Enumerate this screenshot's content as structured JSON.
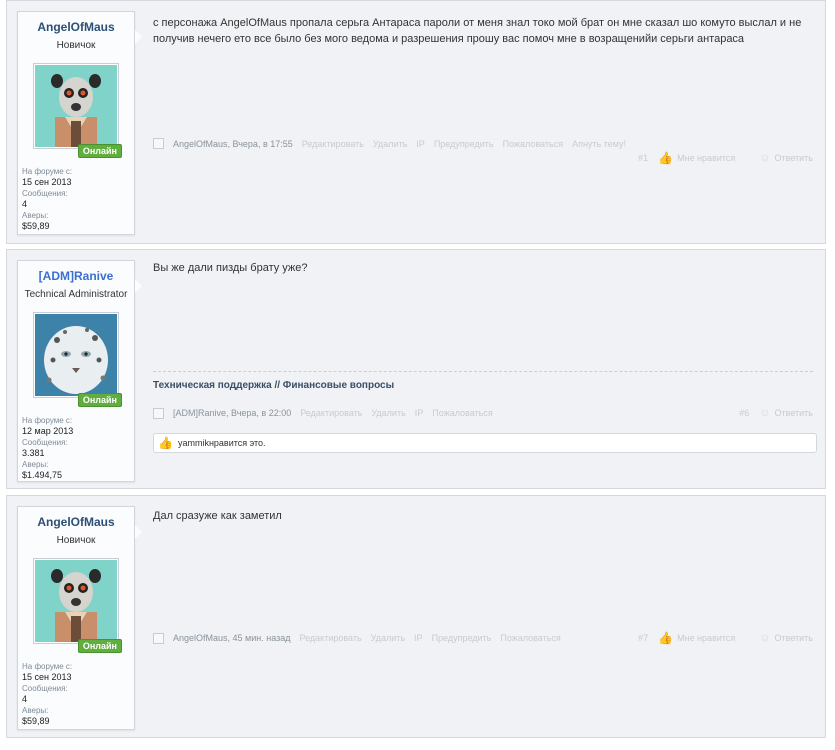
{
  "posts": [
    {
      "user": {
        "name": "AngelOfMaus",
        "title": "Новичок",
        "online": "Онлайн",
        "joined_label": "На форуме с:",
        "joined": "15 сен 2013",
        "messages_label": "Сообщения:",
        "messages": "4",
        "money_label": "Аверы:",
        "money": "$59,89"
      },
      "message": "с персонажа AngelOfMaus пропала серьга Антараса пароли от меня знал токо мой брат он мне сказал шо комуто выслал и не получив нечего ето все было без мого ведома и разрешения прошу вас помоч мне в возращенийи серьги антараса",
      "meta": {
        "author": "AngelOfMaus",
        "time": ", Вчера, в 17:55",
        "edit": "Редактировать",
        "delete": "Удалить",
        "ip": "IP",
        "warn": "Предупредить",
        "report": "Пожаловаться",
        "bump": "Апнуть тему!",
        "number": "#1",
        "like": "Мне нравится",
        "reply": "Ответить"
      }
    },
    {
      "user": {
        "name": "[ADM]Ranive",
        "title": "Technical Administrator",
        "online": "Онлайн",
        "joined_label": "На форуме с:",
        "joined": "12 мар 2013",
        "messages_label": "Сообщения:",
        "messages": "3.381",
        "money_label": "Аверы:",
        "money": "$1.494,75"
      },
      "message": "Вы же дали пизды брату уже?",
      "signature": "Техническая поддержка // Финансовые вопросы",
      "meta": {
        "author": "[ADM]Ranive",
        "time": ", Вчера, в 22:00",
        "edit": "Редактировать",
        "delete": "Удалить",
        "ip": "IP",
        "report": "Пожаловаться",
        "number": "#6",
        "reply": "Ответить"
      },
      "likes": {
        "user": "yammik",
        "text": " нравится это."
      }
    },
    {
      "user": {
        "name": "AngelOfMaus",
        "title": "Новичок",
        "online": "Онлайн",
        "joined_label": "На форуме с:",
        "joined": "15 сен 2013",
        "messages_label": "Сообщения:",
        "messages": "4",
        "money_label": "Аверы:",
        "money": "$59,89"
      },
      "message": "Дал сразуже как заметил",
      "meta": {
        "author": "AngelOfMaus",
        "time": ", 45 мин. назад",
        "edit": "Редактировать",
        "delete": "Удалить",
        "ip": "IP",
        "warn": "Предупредить",
        "report": "Пожаловаться",
        "number": "#7",
        "like": "Мне нравится",
        "reply": "Ответить"
      }
    }
  ]
}
